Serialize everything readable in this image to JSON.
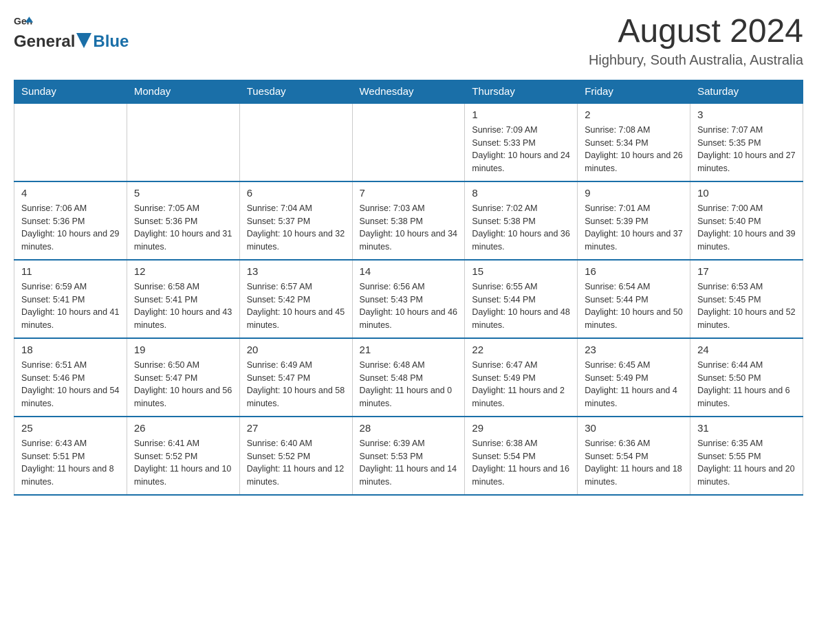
{
  "header": {
    "logo_general": "General",
    "logo_blue": "Blue",
    "month_title": "August 2024",
    "location": "Highbury, South Australia, Australia"
  },
  "weekdays": [
    "Sunday",
    "Monday",
    "Tuesday",
    "Wednesday",
    "Thursday",
    "Friday",
    "Saturday"
  ],
  "weeks": [
    [
      {
        "day": "",
        "info": ""
      },
      {
        "day": "",
        "info": ""
      },
      {
        "day": "",
        "info": ""
      },
      {
        "day": "",
        "info": ""
      },
      {
        "day": "1",
        "info": "Sunrise: 7:09 AM\nSunset: 5:33 PM\nDaylight: 10 hours and 24 minutes."
      },
      {
        "day": "2",
        "info": "Sunrise: 7:08 AM\nSunset: 5:34 PM\nDaylight: 10 hours and 26 minutes."
      },
      {
        "day": "3",
        "info": "Sunrise: 7:07 AM\nSunset: 5:35 PM\nDaylight: 10 hours and 27 minutes."
      }
    ],
    [
      {
        "day": "4",
        "info": "Sunrise: 7:06 AM\nSunset: 5:36 PM\nDaylight: 10 hours and 29 minutes."
      },
      {
        "day": "5",
        "info": "Sunrise: 7:05 AM\nSunset: 5:36 PM\nDaylight: 10 hours and 31 minutes."
      },
      {
        "day": "6",
        "info": "Sunrise: 7:04 AM\nSunset: 5:37 PM\nDaylight: 10 hours and 32 minutes."
      },
      {
        "day": "7",
        "info": "Sunrise: 7:03 AM\nSunset: 5:38 PM\nDaylight: 10 hours and 34 minutes."
      },
      {
        "day": "8",
        "info": "Sunrise: 7:02 AM\nSunset: 5:38 PM\nDaylight: 10 hours and 36 minutes."
      },
      {
        "day": "9",
        "info": "Sunrise: 7:01 AM\nSunset: 5:39 PM\nDaylight: 10 hours and 37 minutes."
      },
      {
        "day": "10",
        "info": "Sunrise: 7:00 AM\nSunset: 5:40 PM\nDaylight: 10 hours and 39 minutes."
      }
    ],
    [
      {
        "day": "11",
        "info": "Sunrise: 6:59 AM\nSunset: 5:41 PM\nDaylight: 10 hours and 41 minutes."
      },
      {
        "day": "12",
        "info": "Sunrise: 6:58 AM\nSunset: 5:41 PM\nDaylight: 10 hours and 43 minutes."
      },
      {
        "day": "13",
        "info": "Sunrise: 6:57 AM\nSunset: 5:42 PM\nDaylight: 10 hours and 45 minutes."
      },
      {
        "day": "14",
        "info": "Sunrise: 6:56 AM\nSunset: 5:43 PM\nDaylight: 10 hours and 46 minutes."
      },
      {
        "day": "15",
        "info": "Sunrise: 6:55 AM\nSunset: 5:44 PM\nDaylight: 10 hours and 48 minutes."
      },
      {
        "day": "16",
        "info": "Sunrise: 6:54 AM\nSunset: 5:44 PM\nDaylight: 10 hours and 50 minutes."
      },
      {
        "day": "17",
        "info": "Sunrise: 6:53 AM\nSunset: 5:45 PM\nDaylight: 10 hours and 52 minutes."
      }
    ],
    [
      {
        "day": "18",
        "info": "Sunrise: 6:51 AM\nSunset: 5:46 PM\nDaylight: 10 hours and 54 minutes."
      },
      {
        "day": "19",
        "info": "Sunrise: 6:50 AM\nSunset: 5:47 PM\nDaylight: 10 hours and 56 minutes."
      },
      {
        "day": "20",
        "info": "Sunrise: 6:49 AM\nSunset: 5:47 PM\nDaylight: 10 hours and 58 minutes."
      },
      {
        "day": "21",
        "info": "Sunrise: 6:48 AM\nSunset: 5:48 PM\nDaylight: 11 hours and 0 minutes."
      },
      {
        "day": "22",
        "info": "Sunrise: 6:47 AM\nSunset: 5:49 PM\nDaylight: 11 hours and 2 minutes."
      },
      {
        "day": "23",
        "info": "Sunrise: 6:45 AM\nSunset: 5:49 PM\nDaylight: 11 hours and 4 minutes."
      },
      {
        "day": "24",
        "info": "Sunrise: 6:44 AM\nSunset: 5:50 PM\nDaylight: 11 hours and 6 minutes."
      }
    ],
    [
      {
        "day": "25",
        "info": "Sunrise: 6:43 AM\nSunset: 5:51 PM\nDaylight: 11 hours and 8 minutes."
      },
      {
        "day": "26",
        "info": "Sunrise: 6:41 AM\nSunset: 5:52 PM\nDaylight: 11 hours and 10 minutes."
      },
      {
        "day": "27",
        "info": "Sunrise: 6:40 AM\nSunset: 5:52 PM\nDaylight: 11 hours and 12 minutes."
      },
      {
        "day": "28",
        "info": "Sunrise: 6:39 AM\nSunset: 5:53 PM\nDaylight: 11 hours and 14 minutes."
      },
      {
        "day": "29",
        "info": "Sunrise: 6:38 AM\nSunset: 5:54 PM\nDaylight: 11 hours and 16 minutes."
      },
      {
        "day": "30",
        "info": "Sunrise: 6:36 AM\nSunset: 5:54 PM\nDaylight: 11 hours and 18 minutes."
      },
      {
        "day": "31",
        "info": "Sunrise: 6:35 AM\nSunset: 5:55 PM\nDaylight: 11 hours and 20 minutes."
      }
    ]
  ]
}
